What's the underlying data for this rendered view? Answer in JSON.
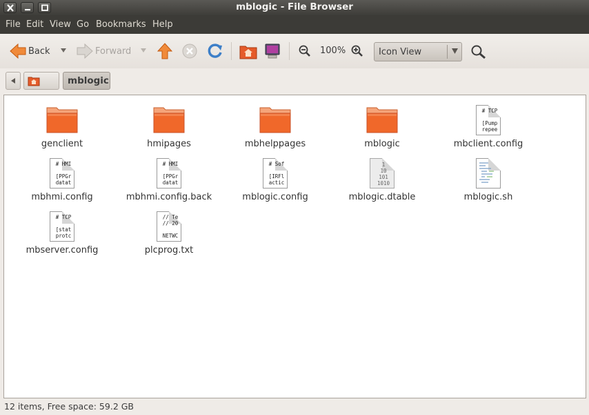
{
  "window": {
    "title": "mblogic - File Browser"
  },
  "menu": [
    "File",
    "Edit",
    "View",
    "Go",
    "Bookmarks",
    "Help"
  ],
  "toolbar": {
    "back_label": "Back",
    "forward_label": "Forward",
    "zoom_level": "100%",
    "view_mode": "Icon View"
  },
  "path": {
    "current": "mblogic"
  },
  "files": [
    {
      "name": "genclient",
      "kind": "folder"
    },
    {
      "name": "hmipages",
      "kind": "folder"
    },
    {
      "name": "mbhelppages",
      "kind": "folder"
    },
    {
      "name": "mblogic",
      "kind": "folder"
    },
    {
      "name": "mbclient.config",
      "kind": "text",
      "preview": [
        "# TCP",
        "",
        "[Pump",
        "repee"
      ]
    },
    {
      "name": "mbhmi.config",
      "kind": "text",
      "preview": [
        "# HMI",
        "",
        "[PPGr",
        "datat"
      ]
    },
    {
      "name": "mbhmi.config.back",
      "kind": "text",
      "preview": [
        "# HMI",
        "",
        "[PPGr",
        "datat"
      ]
    },
    {
      "name": "mblogic.config",
      "kind": "text",
      "preview": [
        "# Sof",
        "",
        "[IRFl",
        "actic"
      ]
    },
    {
      "name": "mblogic.dtable",
      "kind": "binary",
      "preview": [
        "1",
        "10",
        "101",
        "1010"
      ]
    },
    {
      "name": "mblogic.sh",
      "kind": "script"
    },
    {
      "name": "mbserver.config",
      "kind": "text",
      "preview": [
        "# TCP",
        "",
        "[stat",
        "protc"
      ]
    },
    {
      "name": "plcprog.txt",
      "kind": "text",
      "preview": [
        "// Te",
        "// 20",
        "",
        "NETWC"
      ]
    }
  ],
  "status": {
    "text": "12 items, Free space: 59.2 GB"
  },
  "colors": {
    "folder": "#f0682a",
    "accent": "#dd4814",
    "menubar": "#3c3b37"
  }
}
